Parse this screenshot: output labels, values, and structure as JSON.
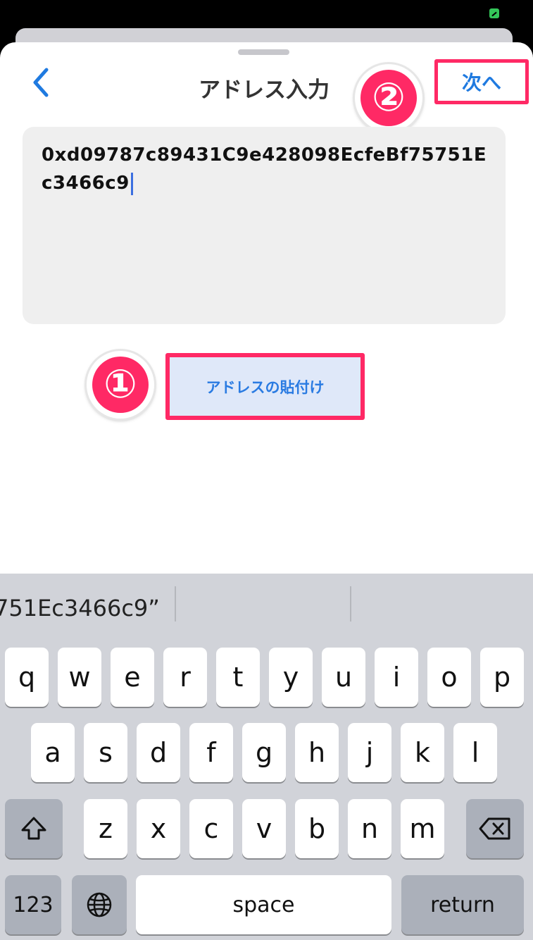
{
  "header": {
    "title": "アドレス入力",
    "next_label": "次へ",
    "back_icon": "chevron-left-icon"
  },
  "address": {
    "value": "0xd09787c89431C9e428098EcfeBf75751Ec3466c9"
  },
  "paste_button": {
    "label": "アドレスの貼付け"
  },
  "annotations": {
    "badge_1": "①",
    "badge_2": "②",
    "highlight_color": "#ff2965"
  },
  "keyboard": {
    "suggestion": "751Ec3466c9”",
    "row1": [
      "q",
      "w",
      "e",
      "r",
      "t",
      "y",
      "u",
      "i",
      "o",
      "p"
    ],
    "row2": [
      "a",
      "s",
      "d",
      "f",
      "g",
      "h",
      "j",
      "k",
      "l"
    ],
    "row3": [
      "z",
      "x",
      "c",
      "v",
      "b",
      "n",
      "m"
    ],
    "numbers_label": "123",
    "space_label": "space",
    "return_label": "return",
    "shift_icon": "shift-icon",
    "delete_icon": "delete-icon",
    "globe_icon": "globe-icon"
  },
  "colors": {
    "accent": "#1f7ae0",
    "annotation": "#ff2965",
    "keyboard_bg": "#d1d3d9"
  }
}
